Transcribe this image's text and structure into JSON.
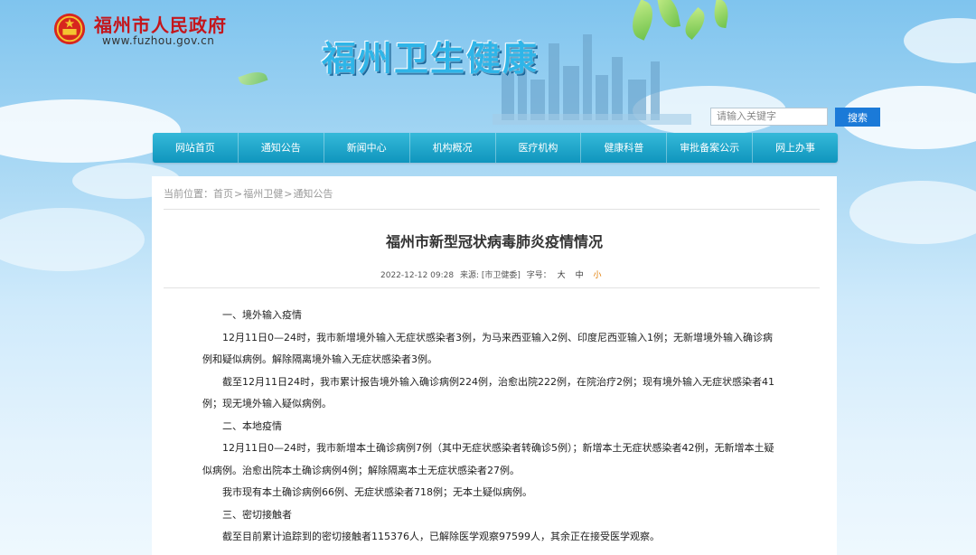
{
  "header": {
    "gov_name": "福州市人民政府",
    "gov_url": "www.fuzhou.gov.cn",
    "site_title": "福州卫生健康"
  },
  "search": {
    "placeholder": "请输入关键字",
    "button_label": "搜索"
  },
  "nav": {
    "items": [
      "网站首页",
      "通知公告",
      "新闻中心",
      "机构概况",
      "医疗机构",
      "健康科普",
      "审批备案公示",
      "网上办事"
    ]
  },
  "breadcrumb": {
    "prefix": "当前位置：",
    "items": [
      "首页",
      "福州卫健",
      "通知公告"
    ],
    "separator": ">"
  },
  "article": {
    "title": "福州市新型冠状病毒肺炎疫情情况",
    "date": "2022-12-12 09:28",
    "source": "来源: [市卫健委]",
    "font_size_label": "字号：",
    "font_sizes": [
      "大",
      "中",
      "小"
    ],
    "paragraphs": [
      "一、境外输入疫情",
      "12月11日0—24时，我市新增境外输入无症状感染者3例，为马来西亚输入2例、印度尼西亚输入1例；无新增境外输入确诊病例和疑似病例。解除隔离境外输入无症状感染者3例。",
      "截至12月11日24时，我市累计报告境外输入确诊病例224例，治愈出院222例，在院治疗2例；现有境外输入无症状感染者41例；现无境外输入疑似病例。",
      "二、本地疫情",
      "12月11日0—24时，我市新增本土确诊病例7例（其中无症状感染者转确诊5例）；新增本土无症状感染者42例，无新增本土疑似病例。治愈出院本土确诊病例4例；解除隔离本土无症状感染者27例。",
      "我市现有本土确诊病例66例、无症状感染者718例；无本土疑似病例。",
      "三、密切接触者",
      "截至目前累计追踪到的密切接触者115376人，已解除医学观察97599人，其余正在接受医学观察。"
    ]
  },
  "colors": {
    "nav_bg": "#1aa3c8",
    "search_button": "#1b7ad8",
    "gov_name": "#c4161c",
    "site_title": "#2fb5e8",
    "active_font_size": "#e17b00"
  }
}
